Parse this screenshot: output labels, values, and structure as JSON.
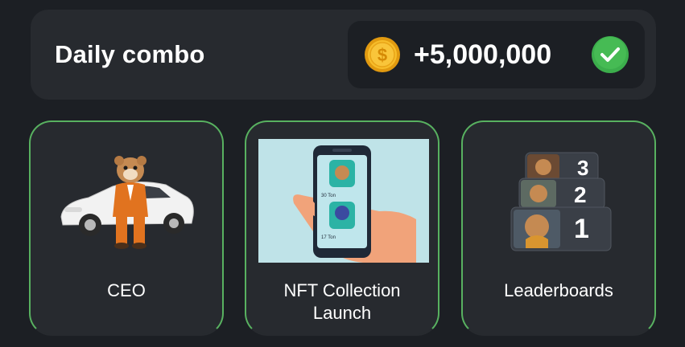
{
  "daily_combo": {
    "title": "Daily combo",
    "reward": "+5,000,000",
    "coin_icon": "dollar-coin-icon",
    "status_icon": "check-circle-icon",
    "colors": {
      "coin": "#f5b31f",
      "check": "#3cae4c",
      "card_border": "#58b160"
    }
  },
  "cards": [
    {
      "label": "CEO",
      "image": "hamster-ceo-with-car"
    },
    {
      "label_line1": "NFT Collection",
      "label_line2": "Launch",
      "image": "phone-nft-collection"
    },
    {
      "label": "Leaderboards",
      "image": "hamster-leaderboard-podium",
      "ranks": [
        "3",
        "2",
        "1"
      ]
    }
  ]
}
